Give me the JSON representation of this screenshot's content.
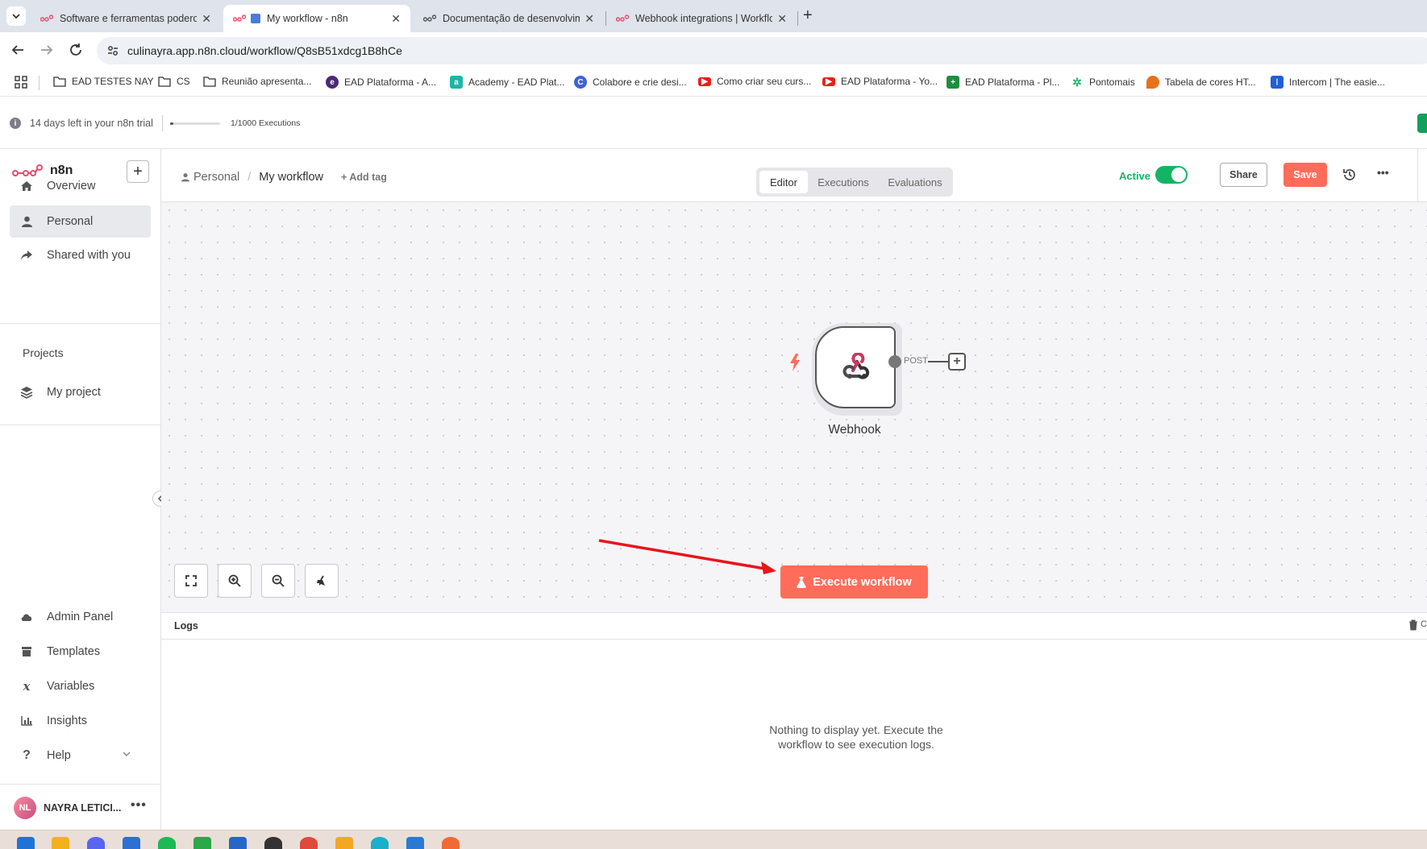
{
  "browser": {
    "tabs": [
      {
        "title": "Software e ferramentas podero",
        "active": false
      },
      {
        "title": "My workflow - n8n",
        "active": true
      },
      {
        "title": "Documentação de desenvolvim",
        "active": false
      },
      {
        "title": "Webhook integrations | Workflo",
        "active": false
      }
    ],
    "url": "culinayra.app.n8n.cloud/workflow/Q8sB51xdcg1B8hCe",
    "bookmarks": [
      {
        "label": "EAD TESTES NAY",
        "icon": "folder-icon"
      },
      {
        "label": "CS",
        "icon": "folder-icon"
      },
      {
        "label": "Reunião apresenta...",
        "icon": "folder-icon"
      },
      {
        "label": "EAD Plataforma - A...",
        "icon": "purple-logo-icon",
        "color": "#4b2a73"
      },
      {
        "label": "Academy - EAD Plat...",
        "icon": "teal-logo-icon",
        "color": "#1fb5a5"
      },
      {
        "label": "Colabore e crie desi...",
        "icon": "canva-icon",
        "color": "#3d63d6"
      },
      {
        "label": "Como criar seu curs...",
        "icon": "youtube-icon",
        "color": "#e62117"
      },
      {
        "label": "EAD Plataforma - Yo...",
        "icon": "youtube-icon",
        "color": "#e62117"
      },
      {
        "label": "EAD Plataforma - Pl...",
        "icon": "sheets-icon",
        "color": "#1e8e3e"
      },
      {
        "label": "Pontomais",
        "icon": "pontomais-icon",
        "color": "#2bb673"
      },
      {
        "label": "Tabela de cores HT...",
        "icon": "color-table-icon",
        "color": "#e8711c"
      },
      {
        "label": "Intercom | The easie...",
        "icon": "intercom-icon",
        "color": "#1f5fd6"
      }
    ]
  },
  "trial": {
    "days_text": "14 days left in your n8n trial",
    "executions_text": "1/1000 Executions",
    "executions_used": 1,
    "executions_total": 1000
  },
  "sidebar": {
    "brand": "n8n",
    "nav": [
      {
        "label": "Overview",
        "icon": "home-icon"
      },
      {
        "label": "Personal",
        "icon": "user-icon",
        "selected": true
      },
      {
        "label": "Shared with you",
        "icon": "share-icon"
      }
    ],
    "projects_title": "Projects",
    "projects": [
      {
        "label": "My project",
        "icon": "layers-icon"
      }
    ],
    "bottom": [
      {
        "label": "Admin Panel",
        "icon": "cloud-icon"
      },
      {
        "label": "Templates",
        "icon": "box-icon"
      },
      {
        "label": "Variables",
        "icon": "variable-icon"
      },
      {
        "label": "Insights",
        "icon": "chart-icon"
      },
      {
        "label": "Help",
        "icon": "question-icon"
      }
    ],
    "user": {
      "initials": "NL",
      "name": "NAYRA LETICI..."
    }
  },
  "header": {
    "breadcrumb_project": "Personal",
    "breadcrumb_sep": "/",
    "workflow_name": "My workflow",
    "add_tag": "+ Add tag",
    "active_label": "Active",
    "active": true,
    "share_label": "Share",
    "save_label": "Save",
    "tabs": [
      {
        "label": "Editor",
        "active": true
      },
      {
        "label": "Executions",
        "active": false
      },
      {
        "label": "Evaluations",
        "active": false
      }
    ]
  },
  "canvas": {
    "node": {
      "name": "Webhook",
      "output_label": "POST"
    },
    "execute_label": "Execute workflow"
  },
  "logs": {
    "title": "Logs",
    "empty_text": "Nothing to display yet. Execute the workflow to see execution logs."
  },
  "colors": {
    "accent": "#ea4b71",
    "save": "#ff6d5a",
    "execute": "#ff6d5a",
    "active_green": "#13b565",
    "annotation_red": "#e8151b"
  }
}
